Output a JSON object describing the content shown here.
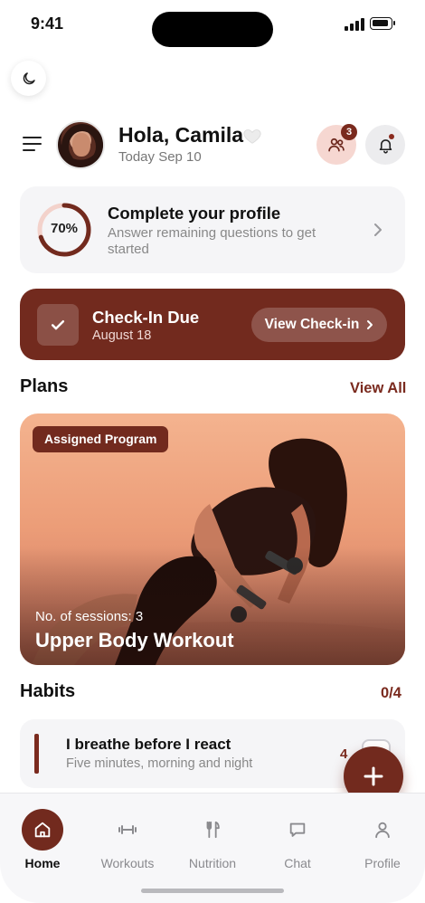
{
  "status_bar": {
    "time": "9:41"
  },
  "header": {
    "greeting": "Hola, Camila",
    "date": "Today Sep 10",
    "community_badge": "3"
  },
  "profile_card": {
    "progress_label": "70%",
    "progress": 0.7,
    "title": "Complete your profile",
    "subtitle": "Answer remaining questions to get started"
  },
  "checkin": {
    "title": "Check-In Due",
    "date": "August 18",
    "button_label": "View Check-in"
  },
  "plans": {
    "title": "Plans",
    "link": "View All",
    "card": {
      "tag": "Assigned Program",
      "sessions": "No. of sessions: 3",
      "name": "Upper Body Workout"
    }
  },
  "habits": {
    "title": "Habits",
    "count": "0/4",
    "items": [
      {
        "title": "I breathe before I react",
        "subtitle": "Five minutes, morning and night",
        "count": "4"
      }
    ]
  },
  "bottom_nav": {
    "items": [
      {
        "label": "Home",
        "icon": "home-icon"
      },
      {
        "label": "Workouts",
        "icon": "dumbbell-icon"
      },
      {
        "label": "Nutrition",
        "icon": "fork-knife-icon"
      },
      {
        "label": "Chat",
        "icon": "chat-icon"
      },
      {
        "label": "Profile",
        "icon": "person-icon"
      }
    ]
  },
  "colors": {
    "accent": "#722a1e",
    "accent_light": "#f6d7d1",
    "card_bg": "#f5f5f7"
  }
}
